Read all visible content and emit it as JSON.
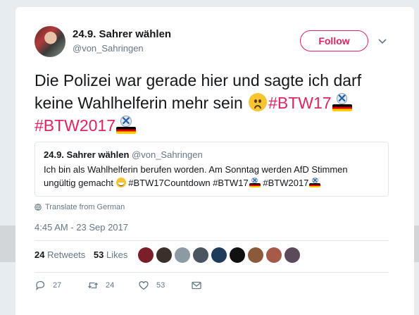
{
  "user": {
    "display_name": "24.9. Sahrer wählen",
    "handle": "@von_Sahringen"
  },
  "follow_label": "Follow",
  "tweet": {
    "part1": "Die Polizei war gerade hier und sagte ich darf keine Wahlhelferin mehr sein ",
    "hashtag1": "#BTW17",
    "hashtag2": "#BTW2017"
  },
  "quoted": {
    "name": "24.9. Sahrer wählen",
    "handle": "@von_Sahringen",
    "text1": "Ich bin als Wahlhelferin berufen worden. Am Sonntag werden AfD Stimmen ungültig gemacht ",
    "text2": " #BTW17Countdown #BTW17",
    "text3": " #BTW2017"
  },
  "translate_label": "Translate from German",
  "timestamp": "4:45 AM - 23 Sep 2017",
  "stats": {
    "retweets_count": "24",
    "retweets_label": "Retweets",
    "likes_count": "53",
    "likes_label": "Likes"
  },
  "liker_colors": [
    "#7a1f2a",
    "#3b2f2a",
    "#8c9aa3",
    "#4a5560",
    "#1f3b5a",
    "#111111",
    "#8a5a3a",
    "#a55a4a",
    "#5a4a5a"
  ],
  "actions": {
    "replies": "27",
    "retweets": "24",
    "likes": "53"
  },
  "colors": {
    "accent": "#e0245e",
    "muted": "#657786"
  }
}
